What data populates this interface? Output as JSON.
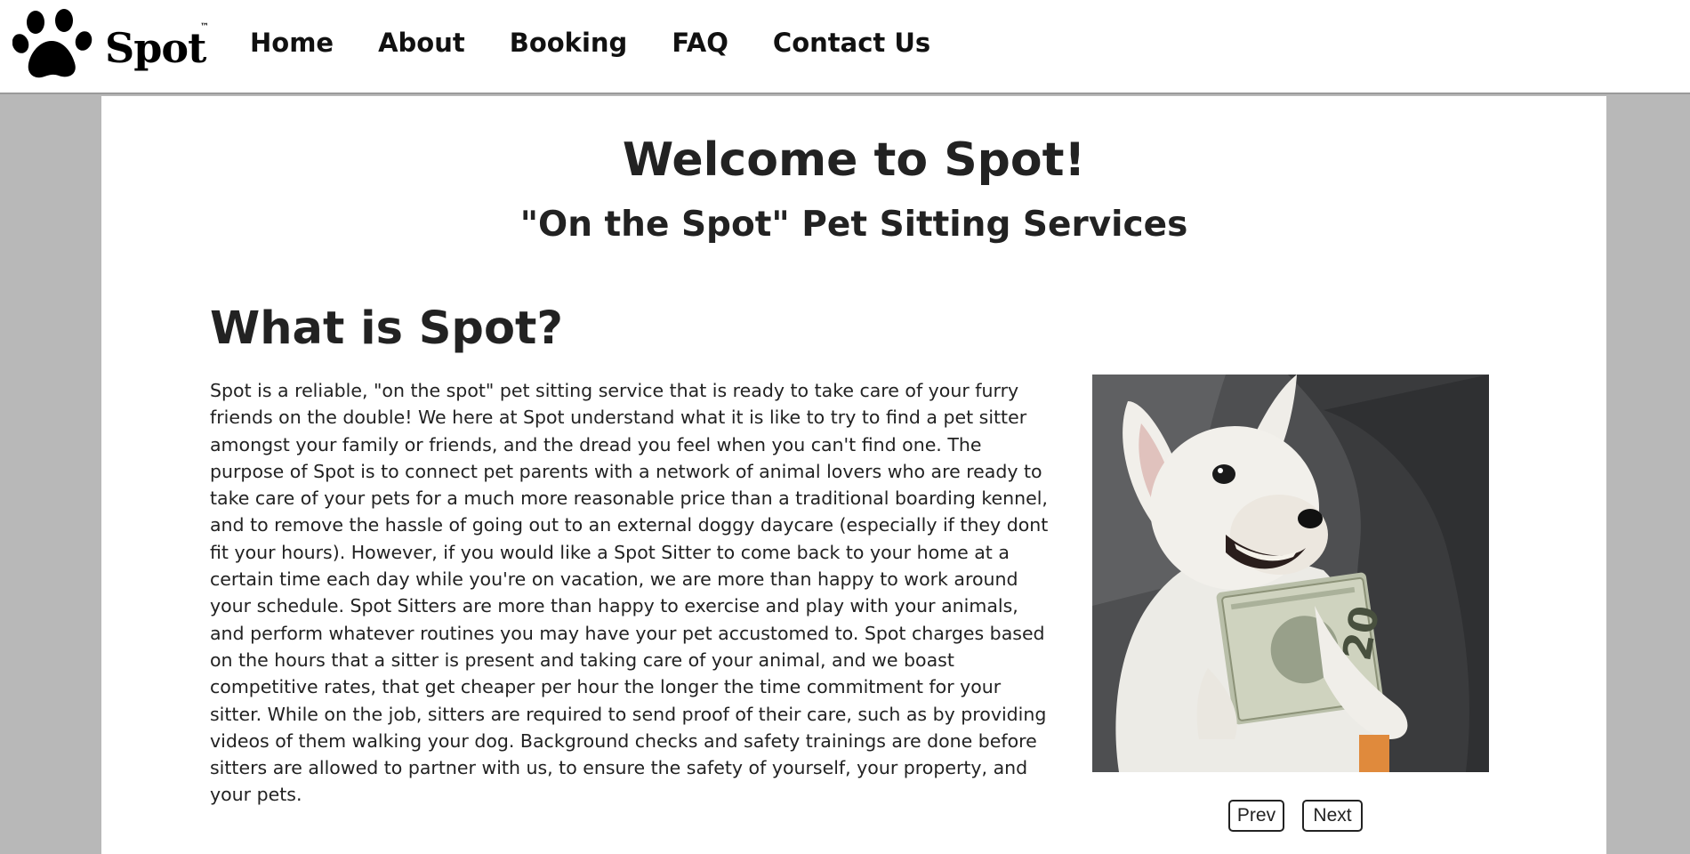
{
  "brand": {
    "name": "Spot",
    "tm": "™"
  },
  "nav": {
    "items": [
      {
        "label": "Home"
      },
      {
        "label": "About"
      },
      {
        "label": "Booking"
      },
      {
        "label": "FAQ"
      },
      {
        "label": "Contact Us"
      }
    ]
  },
  "hero": {
    "title": "Welcome to Spot!",
    "subtitle": "\"On the Spot\" Pet Sitting Services"
  },
  "about": {
    "heading": "What is Spot?",
    "body": "Spot is a reliable, \"on the spot\" pet sitting service that is ready to take care of your furry friends on the double! We here at Spot understand what it is like to try to find a pet sitter amongst your family or friends, and the dread you feel when you can't find one. The purpose of Spot is to connect pet parents with a network of animal lovers who are ready to take care of your pets for a much more reasonable price than a traditional boarding kennel, and to remove the hassle of going out to an external doggy daycare (especially if they dont fit your hours). However, if you would like a Spot Sitter to come back to your home at a certain time each day while you're on vacation, we are more than happy to work around your schedule. Spot Sitters are more than happy to exercise and play with your animals, and perform whatever routines you may have your pet accustomed to. Spot charges based on the hours that a sitter is present and taking care of your animal, and we boast competitive rates, that get cheaper per hour the longer the time commitment for your sitter. While on the job, sitters are required to send proof of their care, such as by providing videos of them walking your dog. Background checks and safety trainings are done before sitters are allowed to partner with us, to ensure the safety of yourself, your property, and your pets."
  },
  "carousel": {
    "prev_label": "Prev",
    "next_label": "Next",
    "bill_text": "20"
  },
  "colors": {
    "page_bg": "#b8b8b8",
    "panel_bg": "#ffffff",
    "text": "#222222"
  }
}
